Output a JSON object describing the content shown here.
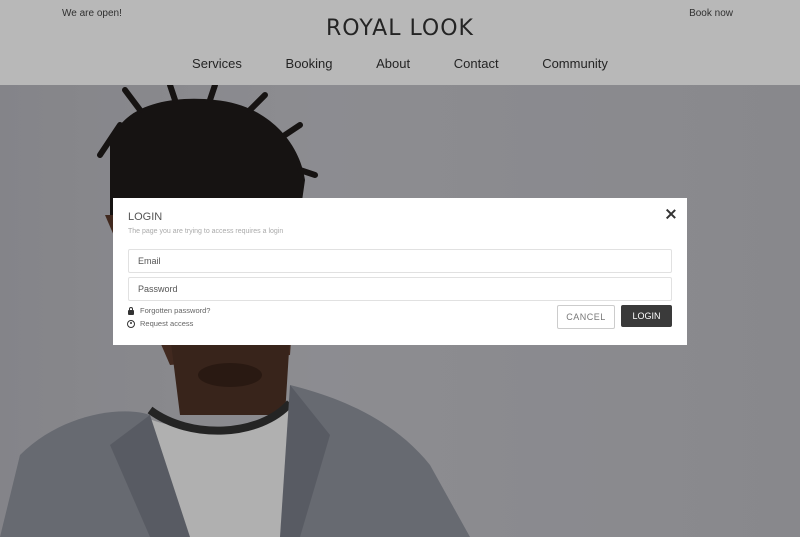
{
  "header": {
    "left_text": "We are open!",
    "right_text": "Book now",
    "brand": "ROYAL LOOK",
    "nav": [
      "Services",
      "Booking",
      "About",
      "Contact",
      "Community"
    ]
  },
  "modal": {
    "title": "LOGIN",
    "subtitle": "The page you are trying to access requires a login",
    "email_placeholder": "Email",
    "password_placeholder": "Password",
    "forgot_link": "Forgotten password?",
    "request_link": "Request access",
    "cancel_label": "CANCEL",
    "login_label": "LOGIN",
    "close_icon": "close-icon"
  },
  "colors": {
    "login_button": "#3a3a3a",
    "overlay": "rgba(0,0,0,0.28)",
    "header_bg": "#ffffff"
  }
}
